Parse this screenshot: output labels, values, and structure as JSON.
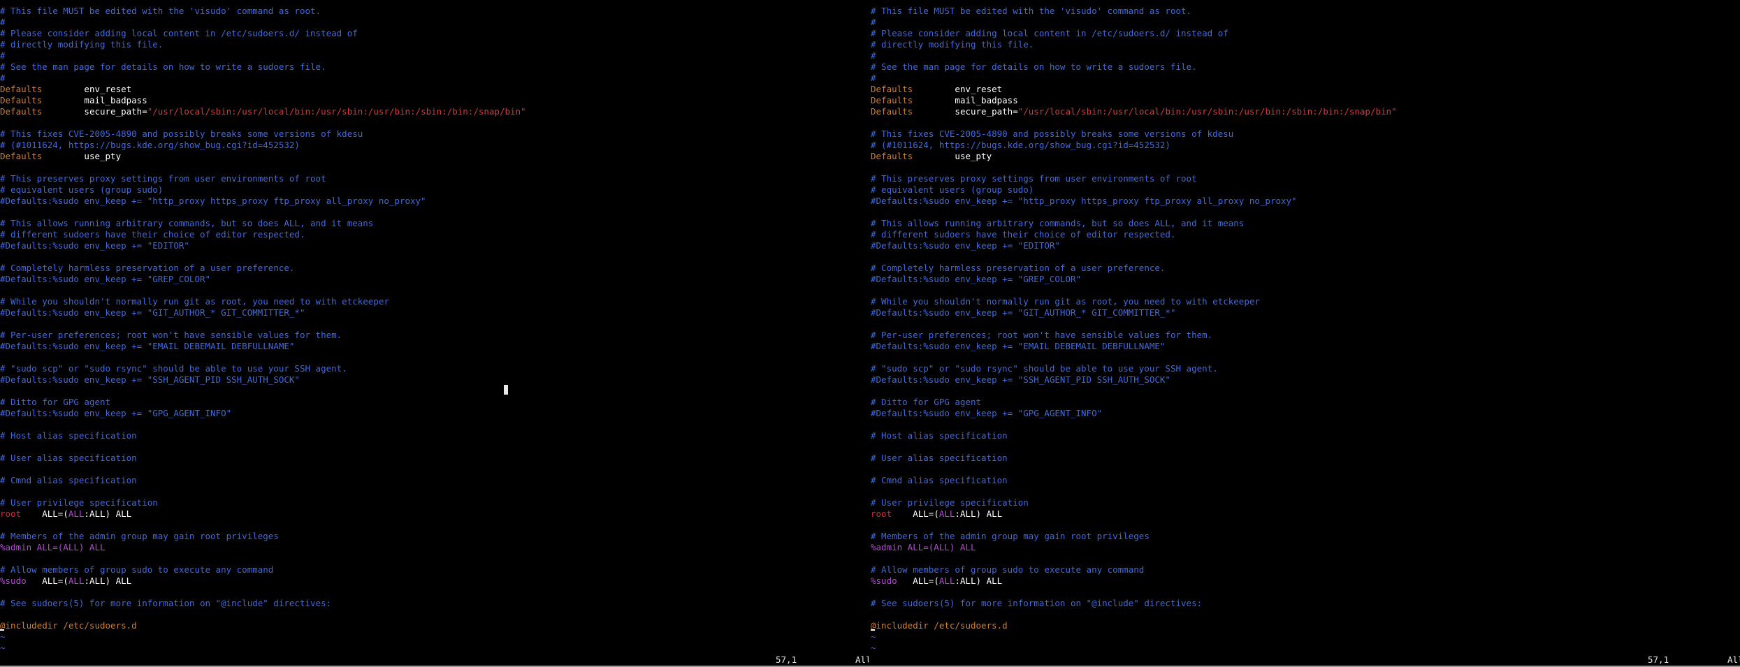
{
  "panes": [
    {
      "id": "left",
      "lines": [
        [
          {
            "t": "# This file MUST be edited with the 'visudo' command as root.",
            "c": "comment"
          }
        ],
        [
          {
            "t": "#",
            "c": "comment"
          }
        ],
        [
          {
            "t": "# Please consider adding local content in /etc/sudoers.d/ instead of",
            "c": "comment"
          }
        ],
        [
          {
            "t": "# directly modifying this file.",
            "c": "comment"
          }
        ],
        [
          {
            "t": "#",
            "c": "comment"
          }
        ],
        [
          {
            "t": "# See the man page for details on how to write a sudoers file.",
            "c": "comment"
          }
        ],
        [
          {
            "t": "#",
            "c": "comment"
          }
        ],
        [
          {
            "t": "Defaults",
            "c": "keyword"
          },
          {
            "t": "        env_reset",
            "c": "value"
          }
        ],
        [
          {
            "t": "Defaults",
            "c": "keyword"
          },
          {
            "t": "        mail_badpass",
            "c": "value"
          }
        ],
        [
          {
            "t": "Defaults",
            "c": "keyword"
          },
          {
            "t": "        secure_path=",
            "c": "value"
          },
          {
            "t": "\"/usr/local/sbin:/usr/local/bin:/usr/sbin:/usr/bin:/sbin:/bin:/snap/bin\"",
            "c": "string"
          }
        ],
        [
          {
            "t": "",
            "c": "plain"
          }
        ],
        [
          {
            "t": "# This fixes CVE-2005-4890 and possibly breaks some versions of kdesu",
            "c": "comment"
          }
        ],
        [
          {
            "t": "# (#1011624, https://bugs.kde.org/show_bug.cgi?id=452532)",
            "c": "comment"
          }
        ],
        [
          {
            "t": "Defaults",
            "c": "keyword"
          },
          {
            "t": "        use_pty",
            "c": "value"
          }
        ],
        [
          {
            "t": "",
            "c": "plain"
          }
        ],
        [
          {
            "t": "# This preserves proxy settings from user environments of root",
            "c": "comment"
          }
        ],
        [
          {
            "t": "# equivalent users (group sudo)",
            "c": "comment"
          }
        ],
        [
          {
            "t": "#Defaults:%sudo env_keep += \"http_proxy https_proxy ftp_proxy all_proxy no_proxy\"",
            "c": "comment"
          }
        ],
        [
          {
            "t": "",
            "c": "plain"
          }
        ],
        [
          {
            "t": "# This allows running arbitrary commands, but so does ALL, and it means",
            "c": "comment"
          }
        ],
        [
          {
            "t": "# different sudoers have their choice of editor respected.",
            "c": "comment"
          }
        ],
        [
          {
            "t": "#Defaults:%sudo env_keep += \"EDITOR\"",
            "c": "comment"
          }
        ],
        [
          {
            "t": "",
            "c": "plain"
          }
        ],
        [
          {
            "t": "# Completely harmless preservation of a user preference.",
            "c": "comment"
          }
        ],
        [
          {
            "t": "#Defaults:%sudo env_keep += \"GREP_COLOR\"",
            "c": "comment"
          }
        ],
        [
          {
            "t": "",
            "c": "plain"
          }
        ],
        [
          {
            "t": "# While you shouldn't normally run git as root, you need to with etckeeper",
            "c": "comment"
          }
        ],
        [
          {
            "t": "#Defaults:%sudo env_keep += \"GIT_AUTHOR_* GIT_COMMITTER_*\"",
            "c": "comment"
          }
        ],
        [
          {
            "t": "",
            "c": "plain"
          }
        ],
        [
          {
            "t": "# Per-user preferences; root won't have sensible values for them.",
            "c": "comment"
          }
        ],
        [
          {
            "t": "#Defaults:%sudo env_keep += \"EMAIL DEBEMAIL DEBFULLNAME\"",
            "c": "comment"
          }
        ],
        [
          {
            "t": "",
            "c": "plain"
          }
        ],
        [
          {
            "t": "# \"sudo scp\" or \"sudo rsync\" should be able to use your SSH agent.",
            "c": "comment"
          }
        ],
        [
          {
            "t": "#Defaults:%sudo env_keep += \"SSH_AGENT_PID SSH_AUTH_SOCK\"",
            "c": "comment"
          }
        ],
        [
          {
            "t": "",
            "c": "plain"
          }
        ],
        [
          {
            "t": "# Ditto for GPG agent",
            "c": "comment"
          }
        ],
        [
          {
            "t": "#Defaults:%sudo env_keep += \"GPG_AGENT_INFO\"",
            "c": "comment"
          }
        ],
        [
          {
            "t": "",
            "c": "plain"
          }
        ],
        [
          {
            "t": "# Host alias specification",
            "c": "comment"
          }
        ],
        [
          {
            "t": "",
            "c": "plain"
          }
        ],
        [
          {
            "t": "# User alias specification",
            "c": "comment"
          }
        ],
        [
          {
            "t": "",
            "c": "plain"
          }
        ],
        [
          {
            "t": "# Cmnd alias specification",
            "c": "comment"
          }
        ],
        [
          {
            "t": "",
            "c": "plain"
          }
        ],
        [
          {
            "t": "# User privilege specification",
            "c": "comment"
          }
        ],
        [
          {
            "t": "root",
            "c": "user-root"
          },
          {
            "t": "    ALL=(",
            "c": "value"
          },
          {
            "t": "ALL",
            "c": "group"
          },
          {
            "t": ":ALL) ALL",
            "c": "value"
          }
        ],
        [
          {
            "t": "",
            "c": "plain"
          }
        ],
        [
          {
            "t": "# Members of the admin group may gain root privileges",
            "c": "comment"
          }
        ],
        [
          {
            "t": "%admin ALL=(ALL) ALL",
            "c": "group"
          }
        ],
        [
          {
            "t": "",
            "c": "plain"
          }
        ],
        [
          {
            "t": "# Allow members of group sudo to execute any command",
            "c": "comment"
          }
        ],
        [
          {
            "t": "%sudo",
            "c": "group"
          },
          {
            "t": "   ALL=(",
            "c": "value"
          },
          {
            "t": "ALL",
            "c": "group"
          },
          {
            "t": ":ALL) ALL",
            "c": "value"
          }
        ],
        [
          {
            "t": "",
            "c": "plain"
          }
        ],
        [
          {
            "t": "# See sudoers(5) for more information on \"@include\" directives:",
            "c": "comment"
          }
        ],
        [
          {
            "t": "",
            "c": "plain"
          }
        ],
        [
          {
            "t": "@includedir /etc/sudoers.d",
            "c": "include"
          }
        ],
        [
          {
            "t": "~",
            "c": "tilde"
          }
        ],
        [
          {
            "t": "~",
            "c": "tilde"
          }
        ]
      ],
      "status": {
        "position": "57,1",
        "scroll": "All"
      }
    },
    {
      "id": "right",
      "lines": [
        [
          {
            "t": "# This file MUST be edited with the 'visudo' command as root.",
            "c": "comment"
          }
        ],
        [
          {
            "t": "#",
            "c": "comment"
          }
        ],
        [
          {
            "t": "# Please consider adding local content in /etc/sudoers.d/ instead of",
            "c": "comment"
          }
        ],
        [
          {
            "t": "# directly modifying this file.",
            "c": "comment"
          }
        ],
        [
          {
            "t": "#",
            "c": "comment"
          }
        ],
        [
          {
            "t": "# See the man page for details on how to write a sudoers file.",
            "c": "comment"
          }
        ],
        [
          {
            "t": "#",
            "c": "comment"
          }
        ],
        [
          {
            "t": "Defaults",
            "c": "keyword"
          },
          {
            "t": "        env_reset",
            "c": "value"
          }
        ],
        [
          {
            "t": "Defaults",
            "c": "keyword"
          },
          {
            "t": "        mail_badpass",
            "c": "value"
          }
        ],
        [
          {
            "t": "Defaults",
            "c": "keyword"
          },
          {
            "t": "        secure_path=",
            "c": "value"
          },
          {
            "t": "\"/usr/local/sbin:/usr/local/bin:/usr/sbin:/usr/bin:/sbin:/bin:/snap/bin\"",
            "c": "string"
          }
        ],
        [
          {
            "t": "",
            "c": "plain"
          }
        ],
        [
          {
            "t": "# This fixes CVE-2005-4890 and possibly breaks some versions of kdesu",
            "c": "comment"
          }
        ],
        [
          {
            "t": "# (#1011624, https://bugs.kde.org/show_bug.cgi?id=452532)",
            "c": "comment"
          }
        ],
        [
          {
            "t": "Defaults",
            "c": "keyword"
          },
          {
            "t": "        use_pty",
            "c": "value"
          }
        ],
        [
          {
            "t": "",
            "c": "plain"
          }
        ],
        [
          {
            "t": "# This preserves proxy settings from user environments of root",
            "c": "comment"
          }
        ],
        [
          {
            "t": "# equivalent users (group sudo)",
            "c": "comment"
          }
        ],
        [
          {
            "t": "#Defaults:%sudo env_keep += \"http_proxy https_proxy ftp_proxy all_proxy no_proxy\"",
            "c": "comment"
          }
        ],
        [
          {
            "t": "",
            "c": "plain"
          }
        ],
        [
          {
            "t": "# This allows running arbitrary commands, but so does ALL, and it means",
            "c": "comment"
          }
        ],
        [
          {
            "t": "# different sudoers have their choice of editor respected.",
            "c": "comment"
          }
        ],
        [
          {
            "t": "#Defaults:%sudo env_keep += \"EDITOR\"",
            "c": "comment"
          }
        ],
        [
          {
            "t": "",
            "c": "plain"
          }
        ],
        [
          {
            "t": "# Completely harmless preservation of a user preference.",
            "c": "comment"
          }
        ],
        [
          {
            "t": "#Defaults:%sudo env_keep += \"GREP_COLOR\"",
            "c": "comment"
          }
        ],
        [
          {
            "t": "",
            "c": "plain"
          }
        ],
        [
          {
            "t": "# While you shouldn't normally run git as root, you need to with etckeeper",
            "c": "comment"
          }
        ],
        [
          {
            "t": "#Defaults:%sudo env_keep += \"GIT_AUTHOR_* GIT_COMMITTER_*\"",
            "c": "comment"
          }
        ],
        [
          {
            "t": "",
            "c": "plain"
          }
        ],
        [
          {
            "t": "# Per-user preferences; root won't have sensible values for them.",
            "c": "comment"
          }
        ],
        [
          {
            "t": "#Defaults:%sudo env_keep += \"EMAIL DEBEMAIL DEBFULLNAME\"",
            "c": "comment"
          }
        ],
        [
          {
            "t": "",
            "c": "plain"
          }
        ],
        [
          {
            "t": "# \"sudo scp\" or \"sudo rsync\" should be able to use your SSH agent.",
            "c": "comment"
          }
        ],
        [
          {
            "t": "#Defaults:%sudo env_keep += \"SSH_AGENT_PID SSH_AUTH_SOCK\"",
            "c": "comment"
          }
        ],
        [
          {
            "t": "",
            "c": "plain"
          }
        ],
        [
          {
            "t": "# Ditto for GPG agent",
            "c": "comment"
          }
        ],
        [
          {
            "t": "#Defaults:%sudo env_keep += \"GPG_AGENT_INFO\"",
            "c": "comment"
          }
        ],
        [
          {
            "t": "",
            "c": "plain"
          }
        ],
        [
          {
            "t": "# Host alias specification",
            "c": "comment"
          }
        ],
        [
          {
            "t": "",
            "c": "plain"
          }
        ],
        [
          {
            "t": "# User alias specification",
            "c": "comment"
          }
        ],
        [
          {
            "t": "",
            "c": "plain"
          }
        ],
        [
          {
            "t": "# Cmnd alias specification",
            "c": "comment"
          }
        ],
        [
          {
            "t": "",
            "c": "plain"
          }
        ],
        [
          {
            "t": "# User privilege specification",
            "c": "comment"
          }
        ],
        [
          {
            "t": "root",
            "c": "user-root"
          },
          {
            "t": "    ALL=(",
            "c": "value"
          },
          {
            "t": "ALL",
            "c": "group"
          },
          {
            "t": ":ALL) ALL",
            "c": "value"
          }
        ],
        [
          {
            "t": "",
            "c": "plain"
          }
        ],
        [
          {
            "t": "# Members of the admin group may gain root privileges",
            "c": "comment"
          }
        ],
        [
          {
            "t": "%admin ALL=(ALL) ALL",
            "c": "group"
          }
        ],
        [
          {
            "t": "",
            "c": "plain"
          }
        ],
        [
          {
            "t": "# Allow members of group sudo to execute any command",
            "c": "comment"
          }
        ],
        [
          {
            "t": "%sudo",
            "c": "group"
          },
          {
            "t": "   ALL=(",
            "c": "value"
          },
          {
            "t": "ALL",
            "c": "group"
          },
          {
            "t": ":ALL) ALL",
            "c": "value"
          }
        ],
        [
          {
            "t": "",
            "c": "plain"
          }
        ],
        [
          {
            "t": "# See sudoers(5) for more information on \"@include\" directives:",
            "c": "comment"
          }
        ],
        [
          {
            "t": "",
            "c": "plain"
          }
        ],
        [
          {
            "t": "@includedir /etc/sudoers.d",
            "c": "include"
          }
        ],
        [
          {
            "t": "~",
            "c": "tilde"
          }
        ],
        [
          {
            "t": "~",
            "c": "tilde"
          }
        ]
      ],
      "status": {
        "position": "57,1",
        "scroll": "All"
      }
    }
  ],
  "colors": {
    "background": "#000000",
    "comment": "#4169e1",
    "keyword": "#d3802c",
    "string": "#d43a3a",
    "user_root": "#e0243a",
    "group": "#b24ad3",
    "tilde": "#5a5ad8",
    "foreground": "#ffffff"
  }
}
